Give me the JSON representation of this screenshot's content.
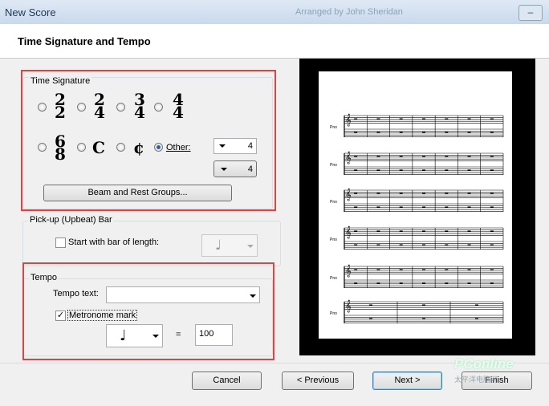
{
  "window": {
    "title": "New Score",
    "ghost_text": "Arranged by John Sheridan"
  },
  "header": {
    "heading": "Time Signature and Tempo"
  },
  "time_signature": {
    "group_label": "Time Signature",
    "options": [
      {
        "top": "2",
        "bottom": "2",
        "checked": false
      },
      {
        "top": "2",
        "bottom": "4",
        "checked": false
      },
      {
        "top": "3",
        "bottom": "4",
        "checked": false
      },
      {
        "top": "4",
        "bottom": "4",
        "checked": false
      },
      {
        "top": "6",
        "bottom": "8",
        "checked": false
      },
      {
        "symbol": "C",
        "checked": false
      },
      {
        "symbol": "¢",
        "checked": false
      }
    ],
    "other_label": "Other:",
    "other_checked": true,
    "other_numerator": "4",
    "other_denominator": "4",
    "beam_button": "Beam and Rest Groups..."
  },
  "pickup": {
    "group_label": "Pick-up (Upbeat) Bar",
    "checkbox_label": "Start with bar of length:",
    "checked": false,
    "note": "♩"
  },
  "tempo": {
    "group_label": "Tempo",
    "text_label": "Tempo text:",
    "text_value": "",
    "metronome_label": "Metronome mark",
    "metronome_checked": true,
    "note": "♩",
    "equals": "=",
    "bpm": "100"
  },
  "preview": {
    "staff_label": "Pno"
  },
  "buttons": {
    "cancel": "Cancel",
    "previous": "< Previous",
    "next": "Next >",
    "finish": "Finish"
  },
  "watermark": {
    "text": "PConline",
    "sub": "太平洋电脑网"
  }
}
